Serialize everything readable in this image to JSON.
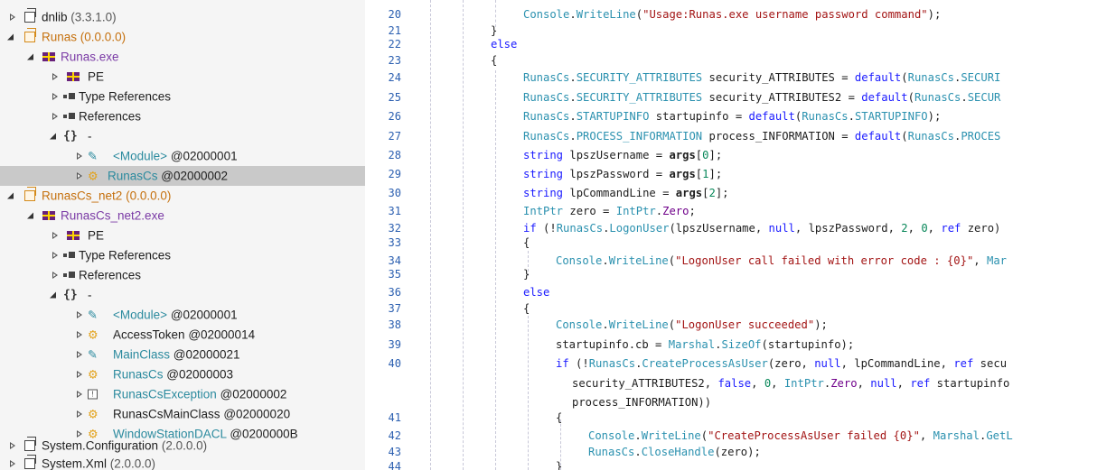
{
  "tree": {
    "rows": [
      {
        "name": "dnlib",
        "version": "(3.3.1.0)",
        "icon": "assembly-icon"
      },
      {
        "name": "Runas",
        "version": "(0.0.0.0)",
        "icon": "assembly-icon-orange"
      },
      {
        "name": "Runas.exe",
        "icon": "module-icon"
      },
      {
        "name": "PE",
        "icon": "module-icon"
      },
      {
        "name": "Type References",
        "icon": "references-icon"
      },
      {
        "name": "References",
        "icon": "references-icon"
      },
      {
        "ns_glyph": "{}",
        "name": "-",
        "icon": "namespace-icon"
      },
      {
        "name": "<Module>",
        "token": "@02000001",
        "icon": "class-icon"
      },
      {
        "name": "RunasCs",
        "token": "@02000002",
        "icon": "class-icon",
        "selected": true
      },
      {
        "name": "RunasCs_net2",
        "version": "(0.0.0.0)",
        "icon": "assembly-icon-orange"
      },
      {
        "name": "RunasCs_net2.exe",
        "icon": "module-icon"
      },
      {
        "name": "PE",
        "icon": "module-icon"
      },
      {
        "name": "Type References",
        "icon": "references-icon"
      },
      {
        "name": "References",
        "icon": "references-icon"
      },
      {
        "ns_glyph": "{}",
        "name": "-",
        "icon": "namespace-icon"
      },
      {
        "name": "<Module>",
        "token": "@02000001",
        "icon": "class-icon"
      },
      {
        "name": "AccessToken",
        "token": "@02000014",
        "icon": "class-icon"
      },
      {
        "name": "MainClass",
        "token": "@02000021",
        "icon": "class-icon"
      },
      {
        "name": "RunasCs",
        "token": "@02000003",
        "icon": "class-icon"
      },
      {
        "name": "RunasCsException",
        "token": "@02000002",
        "icon": "exception-icon"
      },
      {
        "name": "RunasCsMainClass",
        "token": "@02000020",
        "icon": "class-icon"
      },
      {
        "name": "WindowStationDACL",
        "token": "@0200000B",
        "icon": "class-icon"
      },
      {
        "name": "System.Configuration",
        "version": "(2.0.0.0)",
        "icon": "assembly-icon"
      },
      {
        "name": "System.Xml",
        "version": "(2.0.0.0)",
        "icon": "assembly-icon"
      }
    ]
  },
  "editor": {
    "line_numbers": [
      "20",
      "21",
      "22",
      "23",
      "24",
      "25",
      "26",
      "27",
      "28",
      "29",
      "30",
      "31",
      "32",
      "33",
      "34",
      "35",
      "36",
      "37",
      "38",
      "39",
      "40",
      "",
      "",
      "41",
      "42",
      "43",
      "44"
    ],
    "lines": [
      "Console.WriteLine(\"Usage:Runas.exe username password command\");",
      "}",
      "else",
      "{",
      "RunasCs.SECURITY_ATTRIBUTES security_ATTRIBUTES = default(RunasCs.SECURI",
      "RunasCs.SECURITY_ATTRIBUTES security_ATTRIBUTES2 = default(RunasCs.SECUR",
      "RunasCs.STARTUPINFO startupinfo = default(RunasCs.STARTUPINFO);",
      "RunasCs.PROCESS_INFORMATION process_INFORMATION = default(RunasCs.PROCES",
      "string lpszUsername = args[0];",
      "string lpszPassword = args[1];",
      "string lpCommandLine = args[2];",
      "IntPtr zero = IntPtr.Zero;",
      "if (!RunasCs.LogonUser(lpszUsername, null, lpszPassword, 2, 0, ref zero)",
      "{",
      "Console.WriteLine(\"LogonUser call failed with error code : {0}\", Mar",
      "}",
      "else",
      "{",
      "Console.WriteLine(\"LogonUser succeeded\");",
      "startupinfo.cb = Marshal.SizeOf(startupinfo);",
      "if (!RunasCs.CreateProcessAsUser(zero, null, lpCommandLine, ref secu",
      "security_ATTRIBUTES2, false, 0, IntPtr.Zero, null, ref startupinfo",
      "process_INFORMATION))",
      "{",
      "Console.WriteLine(\"CreateProcessAsUser failed {0}\", Marshal.GetL",
      "RunasCs.CloseHandle(zero);",
      "}"
    ]
  }
}
